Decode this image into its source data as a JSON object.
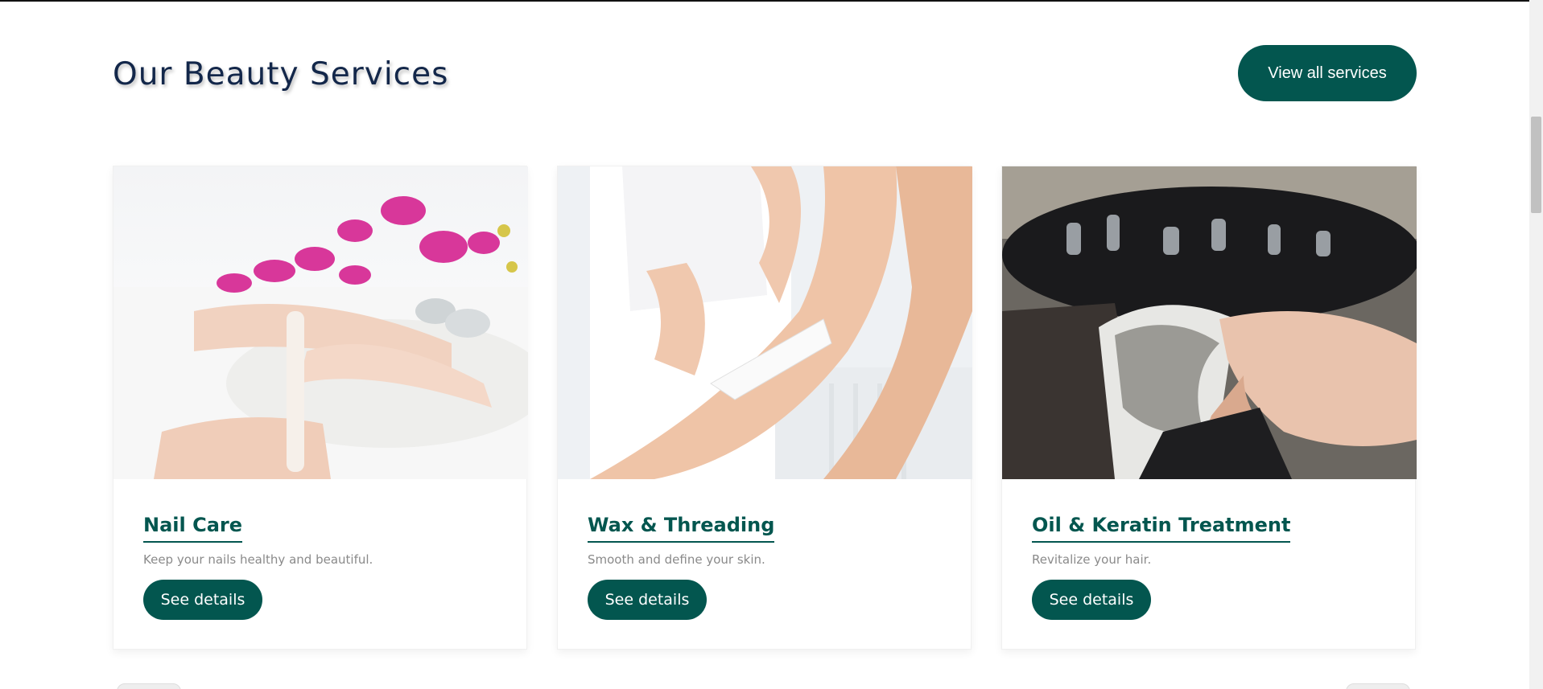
{
  "section": {
    "title": "Our Beauty Services",
    "view_all_label": "View all services"
  },
  "services": [
    {
      "title": "Nail Care",
      "description": "Keep your nails healthy and beautiful.",
      "button": "See details",
      "image": "nail-care-photo"
    },
    {
      "title": "Wax & Threading",
      "description": "Smooth and define your skin.",
      "button": "See details",
      "image": "waxing-photo"
    },
    {
      "title": "Oil & Keratin Treatment",
      "description": "Revitalize your hair.",
      "button": "See details",
      "image": "hair-wash-photo"
    }
  ],
  "colors": {
    "accent": "#03564f",
    "heading": "#13274a",
    "muted_text": "#8a8a8a"
  }
}
